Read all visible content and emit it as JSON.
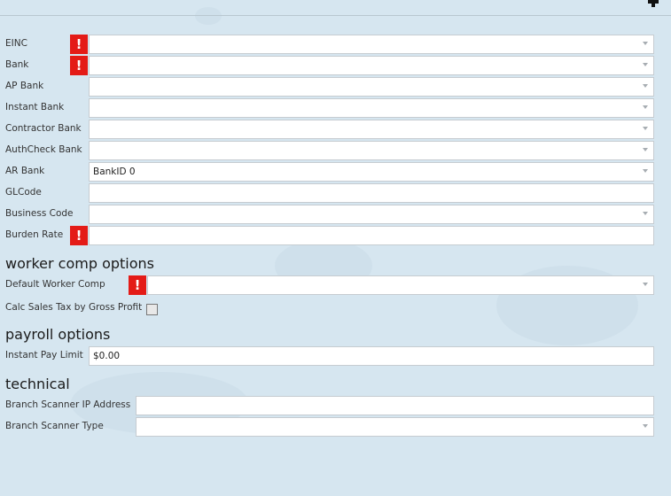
{
  "general": {
    "fields": [
      {
        "id": "einc",
        "label": "EINC",
        "value": "",
        "type": "select",
        "required": true
      },
      {
        "id": "bank",
        "label": "Bank",
        "value": "",
        "type": "select",
        "required": true
      },
      {
        "id": "ap_bank",
        "label": "AP Bank",
        "value": "",
        "type": "select",
        "required": false
      },
      {
        "id": "instant_bank",
        "label": "Instant Bank",
        "value": "",
        "type": "select",
        "required": false
      },
      {
        "id": "contractor_bank",
        "label": "Contractor Bank",
        "value": "",
        "type": "select",
        "required": false
      },
      {
        "id": "authcheck_bank",
        "label": "AuthCheck Bank",
        "value": "",
        "type": "select",
        "required": false
      },
      {
        "id": "ar_bank",
        "label": "AR Bank",
        "value": "BankID 0",
        "type": "select",
        "required": false
      },
      {
        "id": "glcode",
        "label": "GLCode",
        "value": "",
        "type": "text",
        "required": false
      },
      {
        "id": "business_code",
        "label": "Business Code",
        "value": "",
        "type": "select",
        "required": false
      },
      {
        "id": "burden_rate",
        "label": "Burden Rate",
        "value": "",
        "type": "text",
        "required": true
      }
    ]
  },
  "worker_comp": {
    "title": "worker comp options",
    "default_label": "Default Worker Comp",
    "default_value": "",
    "calc_label": "Calc Sales Tax by Gross Profit",
    "calc_checked": false
  },
  "payroll": {
    "title": "payroll options",
    "instant_pay_label": "Instant Pay Limit",
    "instant_pay_value": "$0.00"
  },
  "technical": {
    "title": "technical",
    "scanner_ip_label": "Branch Scanner IP Address",
    "scanner_ip_value": "",
    "scanner_type_label": "Branch Scanner Type",
    "scanner_type_value": ""
  },
  "alert_symbol": "!",
  "colors": {
    "alert": "#e41b17",
    "background": "#d6e6f0"
  }
}
